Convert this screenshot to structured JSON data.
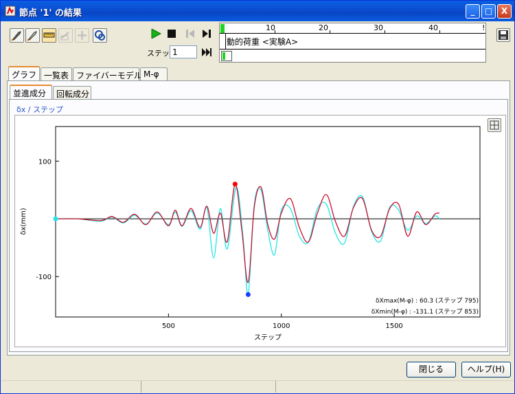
{
  "window": {
    "title": "節点 '1' の結果",
    "min_label": "_",
    "max_label": "□",
    "close_label": "X"
  },
  "toolbar": {
    "step_label": "ステップ",
    "step_value": "1",
    "timeline_ticks": [
      "10",
      "20",
      "30",
      "40"
    ],
    "load_case": "動的荷重 <実験A>"
  },
  "tabs": [
    "グラフ",
    "一覧表",
    "ファイバーモデル",
    "M-φ"
  ],
  "subtabs": [
    "並進成分",
    "回転成分"
  ],
  "graph": {
    "caption": "δx / ステップ",
    "annot_max": "δXmax(M-φ) :    60.3 (ステップ 795)",
    "annot_min": "δXmin(M-φ) : -131.1 (ステップ 853)"
  },
  "buttons": {
    "close": "閉じる",
    "help": "ヘルプ(H)"
  },
  "colors": {
    "series_red": "#c8102e",
    "series_cyan": "#21e6e6",
    "max_marker": "#ff0000",
    "min_marker": "#1e3cff"
  },
  "chart_data": {
    "type": "line",
    "xlabel": "ステップ",
    "ylabel": "δx(mm)",
    "xlim": [
      0,
      1880
    ],
    "ylim": [
      -170,
      160
    ],
    "xticks": [
      500,
      1000,
      1500
    ],
    "yticks": [
      100,
      -100
    ],
    "grid": false,
    "series": [
      {
        "color": "#c8102e",
        "x": [
          0,
          100,
          200,
          250,
          300,
          350,
          400,
          450,
          500,
          530,
          560,
          600,
          640,
          670,
          700,
          730,
          760,
          795,
          825,
          853,
          880,
          910,
          940,
          970,
          1000,
          1040,
          1080,
          1120,
          1160,
          1200,
          1240,
          1280,
          1320,
          1360,
          1400,
          1440,
          1480,
          1520,
          1560,
          1600,
          1640,
          1680,
          1700
        ],
        "y": [
          0,
          0,
          -3,
          4,
          -6,
          8,
          -10,
          12,
          -12,
          15,
          -12,
          18,
          -15,
          22,
          -25,
          10,
          -40,
          60,
          -20,
          -110,
          20,
          55,
          -10,
          -35,
          10,
          35,
          -15,
          -40,
          10,
          42,
          -5,
          -30,
          20,
          35,
          -20,
          -30,
          18,
          25,
          -30,
          12,
          -10,
          8,
          10
        ]
      },
      {
        "color": "#21e6e6",
        "x": [
          0,
          100,
          200,
          250,
          300,
          350,
          400,
          450,
          500,
          530,
          560,
          600,
          640,
          670,
          700,
          730,
          760,
          800,
          830,
          853,
          880,
          910,
          940,
          970,
          1000,
          1040,
          1080,
          1120,
          1160,
          1200,
          1240,
          1280,
          1320,
          1360,
          1400,
          1440,
          1480,
          1520,
          1560,
          1600,
          1640,
          1680,
          1700
        ],
        "y": [
          0,
          0,
          -4,
          3,
          -7,
          6,
          -9,
          10,
          -10,
          12,
          -13,
          14,
          -18,
          20,
          -68,
          18,
          -52,
          55,
          -30,
          -131,
          25,
          50,
          -20,
          -62,
          15,
          18,
          -30,
          -40,
          18,
          25,
          -25,
          -42,
          22,
          38,
          -22,
          -38,
          20,
          15,
          -20,
          5,
          -8,
          5,
          0
        ]
      }
    ],
    "markers": [
      {
        "x": 795,
        "y": 60.3,
        "color": "#ff0000"
      },
      {
        "x": 853,
        "y": -131.1,
        "color": "#1e3cff"
      }
    ]
  }
}
